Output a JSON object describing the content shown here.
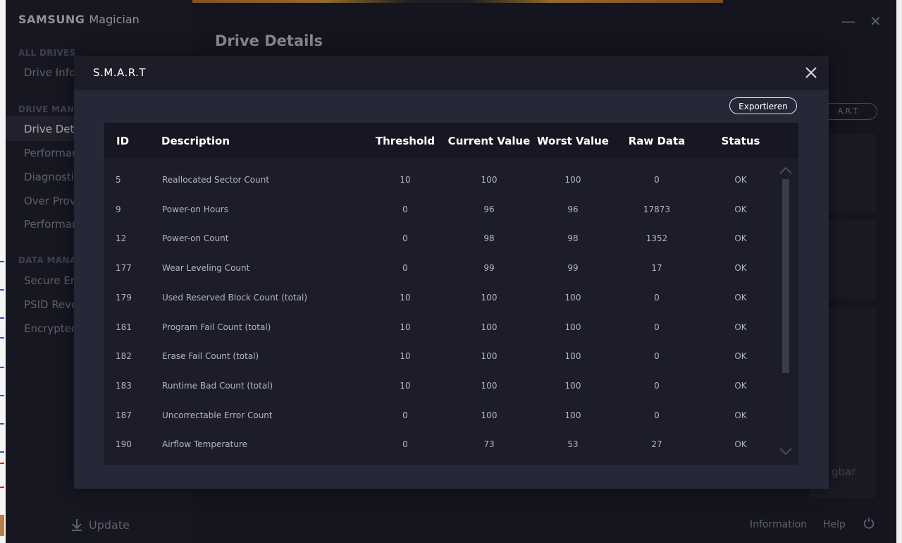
{
  "app": {
    "brand_bold": "SAMSUNG",
    "brand_light": "Magician",
    "page_title": "Drive Details",
    "nav_groups": [
      "ALL DRIVES",
      "DRIVE MANA",
      "DATA MANA"
    ],
    "nav_items": [
      "Drive Infor",
      "Drive Deta",
      "Performan",
      "Diagnostic",
      "Over Provi",
      "Performan",
      "Secure Era",
      "PSID Reve",
      "Encrypted"
    ],
    "update_label": "Update",
    "bg_smart_label": "A.R.T.",
    "bg_partial_text": "gbar",
    "footer": {
      "information": "Information",
      "help": "Help"
    },
    "window_controls": {
      "minimize": "—",
      "close": "✕"
    }
  },
  "modal": {
    "title": "S.M.A.R.T",
    "export_label": "Exportieren",
    "headers": {
      "id": "ID",
      "description": "Description",
      "threshold": "Threshold",
      "current": "Current Value",
      "worst": "Worst Value",
      "raw": "Raw Data",
      "status": "Status"
    },
    "rows": [
      {
        "id": "5",
        "desc": "Reallocated Sector Count",
        "threshold": "10",
        "current": "100",
        "worst": "100",
        "raw": "0",
        "status": "OK"
      },
      {
        "id": "9",
        "desc": "Power-on Hours",
        "threshold": "0",
        "current": "96",
        "worst": "96",
        "raw": "17873",
        "status": "OK"
      },
      {
        "id": "12",
        "desc": "Power-on Count",
        "threshold": "0",
        "current": "98",
        "worst": "98",
        "raw": "1352",
        "status": "OK"
      },
      {
        "id": "177",
        "desc": "Wear Leveling Count",
        "threshold": "0",
        "current": "99",
        "worst": "99",
        "raw": "17",
        "status": "OK"
      },
      {
        "id": "179",
        "desc": "Used Reserved Block Count (total)",
        "threshold": "10",
        "current": "100",
        "worst": "100",
        "raw": "0",
        "status": "OK"
      },
      {
        "id": "181",
        "desc": "Program Fail Count (total)",
        "threshold": "10",
        "current": "100",
        "worst": "100",
        "raw": "0",
        "status": "OK"
      },
      {
        "id": "182",
        "desc": "Erase Fail Count (total)",
        "threshold": "10",
        "current": "100",
        "worst": "100",
        "raw": "0",
        "status": "OK"
      },
      {
        "id": "183",
        "desc": "Runtime Bad Count (total)",
        "threshold": "10",
        "current": "100",
        "worst": "100",
        "raw": "0",
        "status": "OK"
      },
      {
        "id": "187",
        "desc": "Uncorrectable Error Count",
        "threshold": "0",
        "current": "100",
        "worst": "100",
        "raw": "0",
        "status": "OK"
      },
      {
        "id": "190",
        "desc": "Airflow Temperature",
        "threshold": "0",
        "current": "73",
        "worst": "53",
        "raw": "27",
        "status": "OK"
      }
    ]
  },
  "icons": {
    "modal_close": "close-icon",
    "scroll_up": "chevron-up-icon",
    "scroll_down": "chevron-down-icon",
    "update": "download-icon",
    "refresh": "power-icon"
  },
  "colors": {
    "app_bg": "#1b1c26",
    "modal_bg": "#262837",
    "table_bg": "#1c1d29",
    "header_bg": "#161722",
    "text_primary": "#ffffff",
    "text_secondary": "#b3b5c3"
  }
}
